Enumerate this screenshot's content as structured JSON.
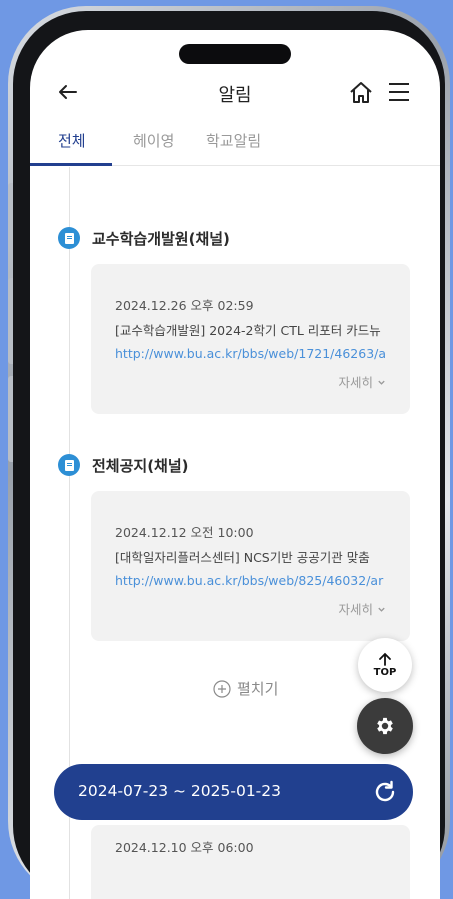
{
  "header": {
    "title": "알림"
  },
  "tabs": [
    {
      "label": "전체",
      "active": true
    },
    {
      "label": "헤이영",
      "active": false
    },
    {
      "label": "학교알림",
      "active": false
    }
  ],
  "sections": [
    {
      "title": "교수학습개발원(채널)",
      "item": {
        "datetime": "2024.12.26 오후 02:59",
        "text": "[교수학습개발원] 2024-2학기 CTL 리포터 카드뉴",
        "link": "http://www.bu.ac.kr/bbs/web/1721/46263/a",
        "more": "자세히"
      }
    },
    {
      "title": "전체공지(채널)",
      "item": {
        "datetime": "2024.12.12 오전 10:00",
        "text": "[대학일자리플러스센터] NCS기반 공공기관 맞춤",
        "link": "http://www.bu.ac.kr/bbs/web/825/46032/ar",
        "more": "자세히"
      }
    }
  ],
  "expand_label": "펼치기",
  "top_button_label": "TOP",
  "date_range": "2024-07-23 ~ 2025-01-23",
  "partial_item": {
    "datetime": "2024.12.10 오후 06:00"
  },
  "icons": {
    "back": "arrow-left-icon",
    "home": "home-icon",
    "menu": "hamburger-menu-icon",
    "section": "document-icon",
    "top": "arrow-up-icon",
    "settings": "gear-icon",
    "refresh": "refresh-icon",
    "expand": "plus-circle-icon"
  },
  "colors": {
    "primary": "#21408f",
    "link": "#4a90d9",
    "section_icon": "#2d8fd5",
    "background": "#6f98e4"
  }
}
